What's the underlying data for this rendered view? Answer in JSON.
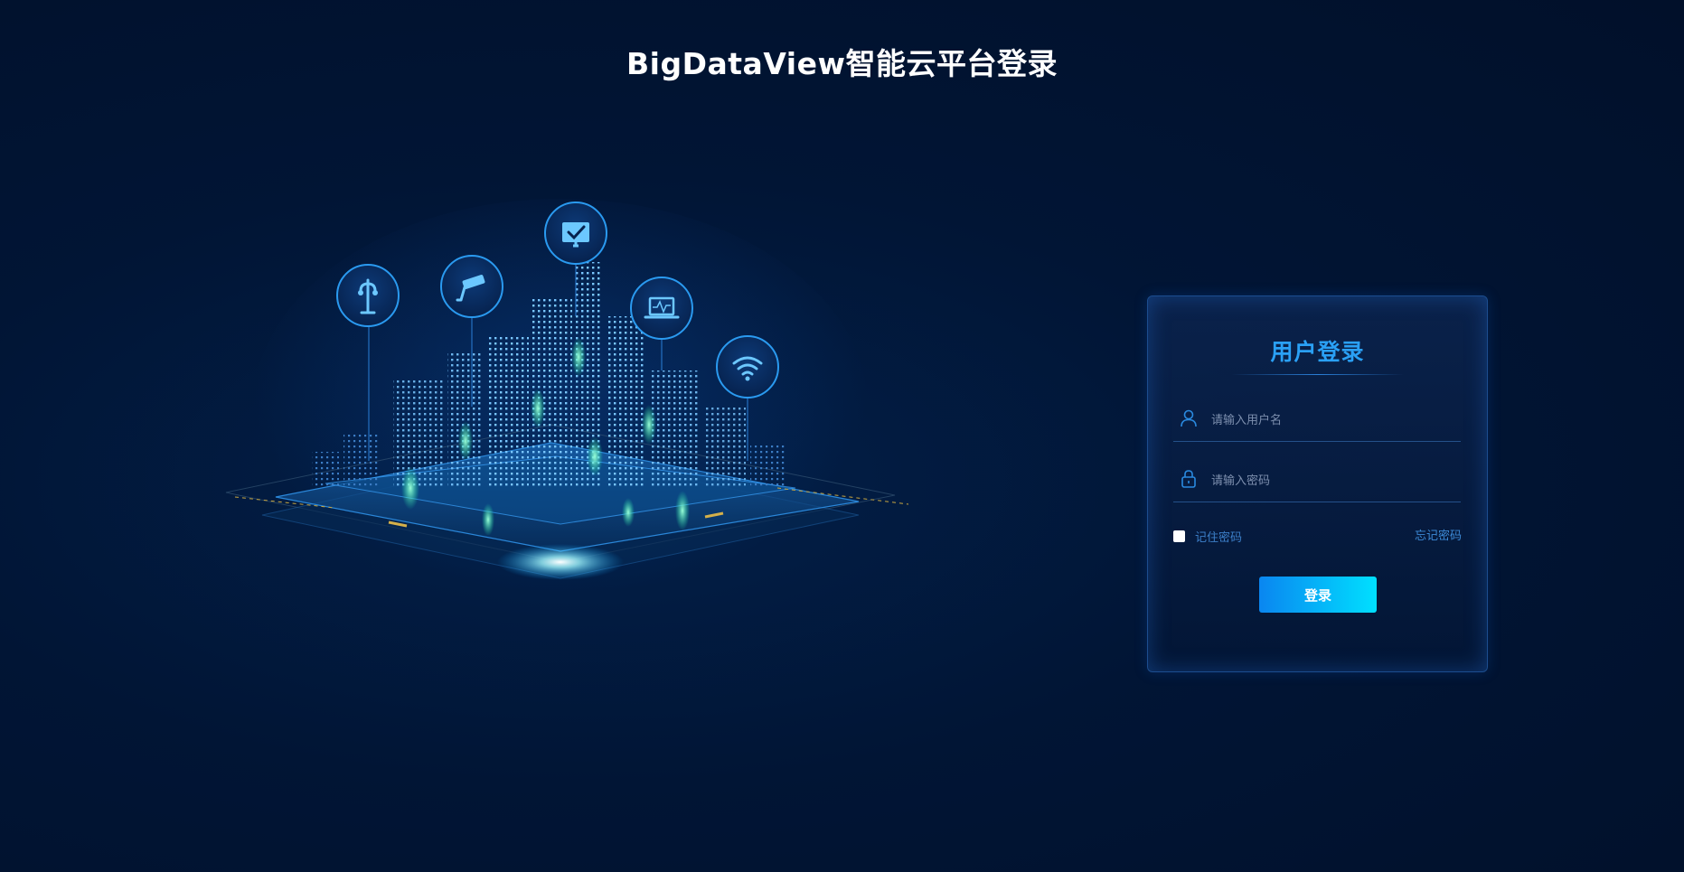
{
  "header": {
    "title": "BigDataView智能云平台登录"
  },
  "illustration": {
    "icons": [
      "street-lamp-icon",
      "security-camera-icon",
      "monitor-check-icon",
      "laptop-pulse-icon",
      "wifi-icon"
    ]
  },
  "login": {
    "title": "用户登录",
    "username_placeholder": "请输入用户名",
    "password_placeholder": "请输入密码",
    "remember_label": "记住密码",
    "forgot_label": "忘记密码",
    "submit_label": "登录"
  },
  "colors": {
    "background": "#01122e",
    "accent": "#2aa0f5",
    "button_start": "#0a86f0",
    "button_end": "#00e0ff"
  }
}
